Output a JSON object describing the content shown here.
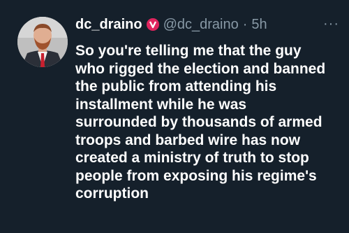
{
  "tweet": {
    "display_name": "dc_draino",
    "badge_icon": "verified-red-v-icon",
    "handle": "@dc_draino",
    "separator": "·",
    "time": "5h",
    "more_icon": "more-horizontal-icon",
    "more_label": "···",
    "lines": [
      "So you're telling me that the guy",
      "who rigged the election and banned",
      "the public from attending his",
      "installment while he was",
      "surrounded by thousands of armed",
      "troops and barbed wire has now",
      "created a ministry of truth to stop",
      "people from exposing his regime's",
      "corruption"
    ]
  },
  "colors": {
    "background": "#15202b",
    "text": "#ffffff",
    "muted": "#8899a6",
    "badge": "#e0245e"
  }
}
